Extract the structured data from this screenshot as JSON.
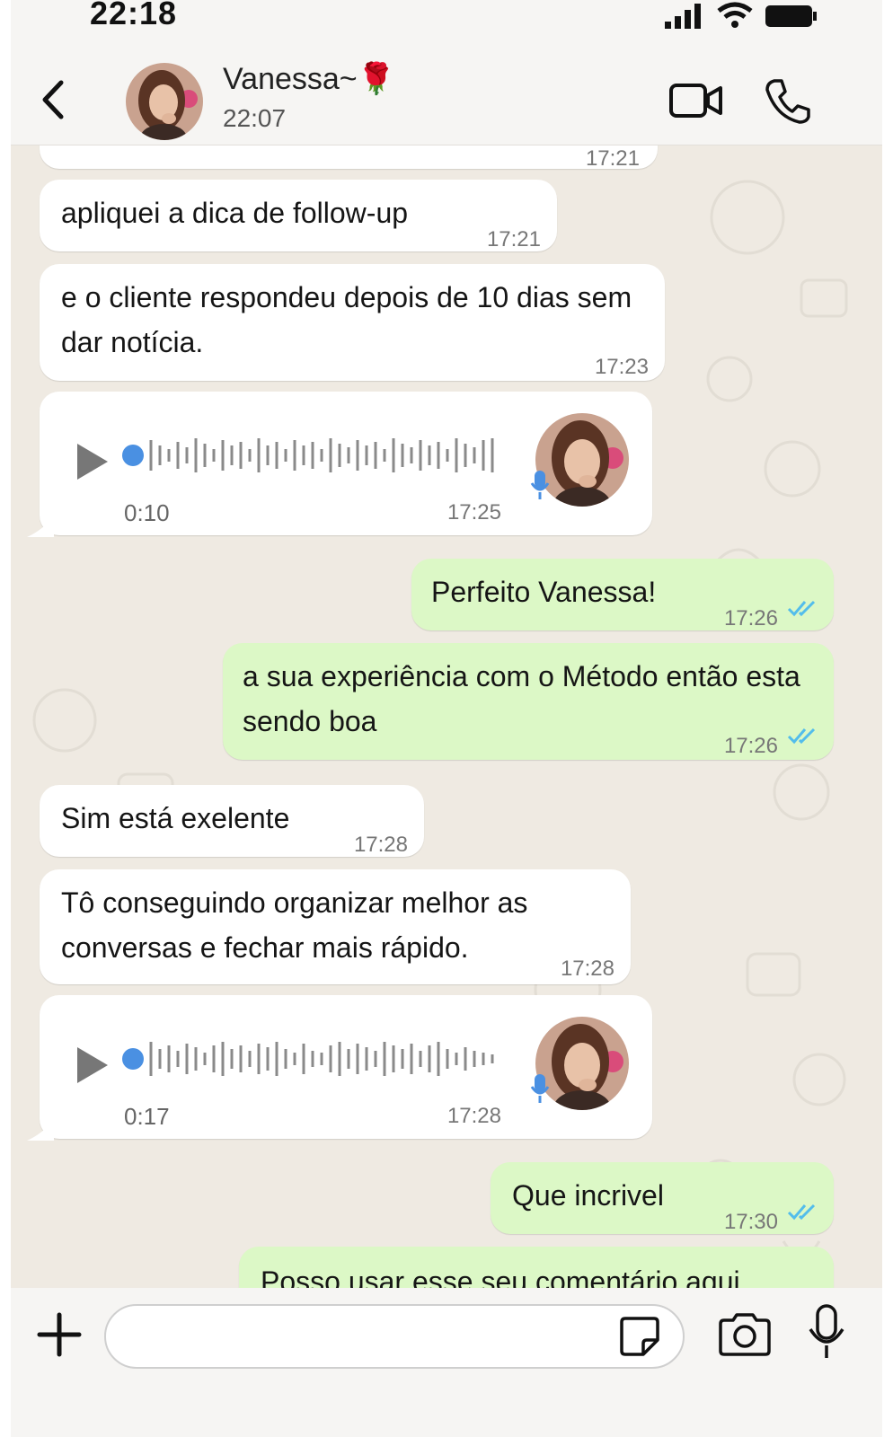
{
  "status_bar": {
    "time": "22:18"
  },
  "header": {
    "contact_name": "Vanessa~🌹",
    "status": "22:07"
  },
  "messages": [
    {
      "direction": "in",
      "type": "text",
      "text": "apliquei a dica de follow-up",
      "time": "17:21"
    },
    {
      "direction": "in",
      "type": "text",
      "text": "e o cliente respondeu depois de 10 dias sem dar notícia.",
      "time": "17:23"
    },
    {
      "direction": "in",
      "type": "voice",
      "duration": "0:10",
      "time": "17:25"
    },
    {
      "direction": "out",
      "type": "text",
      "text": "Perfeito Vanessa!",
      "time": "17:26",
      "status": "read"
    },
    {
      "direction": "out",
      "type": "text",
      "text": "a sua experiência com o Método então esta sendo boa",
      "time": "17:26",
      "status": "read"
    },
    {
      "direction": "in",
      "type": "text",
      "text": "Sim está exelente",
      "time": "17:28"
    },
    {
      "direction": "in",
      "type": "text",
      "text": "Tô conseguindo organizar melhor as conversas e fechar mais rápido.",
      "time": "17:28"
    },
    {
      "direction": "in",
      "type": "voice",
      "duration": "0:17",
      "time": "17:28"
    },
    {
      "direction": "out",
      "type": "text",
      "text": "Que incrivel",
      "time": "17:30",
      "status": "read"
    },
    {
      "direction": "out",
      "type": "text",
      "text": "Posso usar esse seu comentário aqui",
      "time": "",
      "status": ""
    }
  ],
  "partial_top_time": "17:21",
  "input": {
    "placeholder": ""
  },
  "colors": {
    "incoming": "#ffffff",
    "outgoing": "#dcf8c6",
    "read_ticks": "#53bdeb",
    "voice_accent": "#4a90e2",
    "background": "#efeae2"
  },
  "icons": {
    "back": "chevron-left-icon",
    "video": "video-camera-icon",
    "call": "phone-icon",
    "plus": "plus-icon",
    "sticker": "sticker-icon",
    "camera": "camera-icon",
    "mic": "microphone-icon"
  }
}
